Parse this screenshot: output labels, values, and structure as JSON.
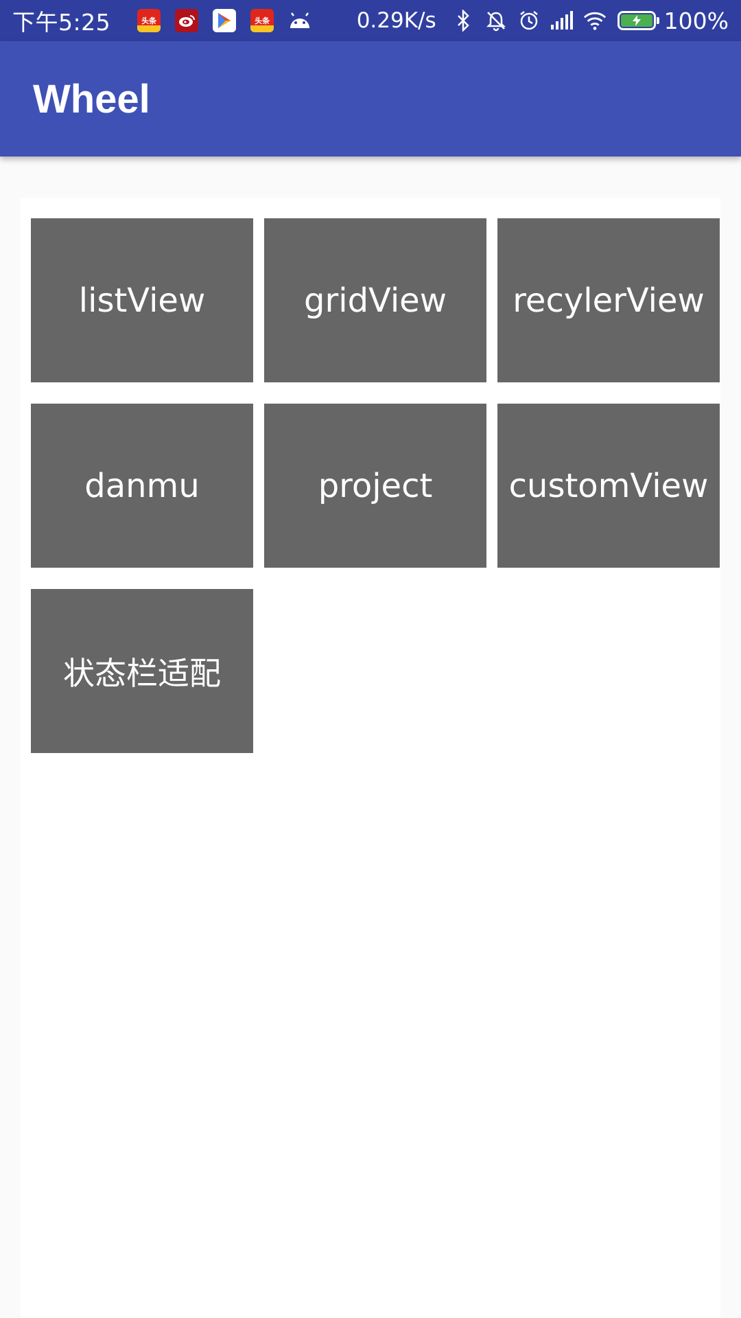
{
  "status_bar": {
    "time": "下午5:25",
    "network_speed": "0.29K/s",
    "battery_percent": "100%",
    "notification_icons": [
      "toutiao-icon",
      "weibo-icon",
      "play-store-icon",
      "toutiao-icon",
      "android-icon"
    ],
    "system_icons": [
      "bluetooth-icon",
      "mute-icon",
      "alarm-icon",
      "signal-icon",
      "wifi-icon",
      "battery-charging-icon"
    ],
    "battery_level": 1.0
  },
  "app_bar": {
    "title": "Wheel"
  },
  "grid": {
    "items": [
      {
        "label": "listView"
      },
      {
        "label": "gridView"
      },
      {
        "label": "recylerView"
      },
      {
        "label": "danmu"
      },
      {
        "label": "project"
      },
      {
        "label": "customView"
      },
      {
        "label": "状态栏适配"
      }
    ]
  },
  "colors": {
    "status_bar": "#303f9f",
    "app_bar": "#3f51b5",
    "tile": "#666666",
    "background": "#fafafa",
    "card": "#ffffff"
  }
}
